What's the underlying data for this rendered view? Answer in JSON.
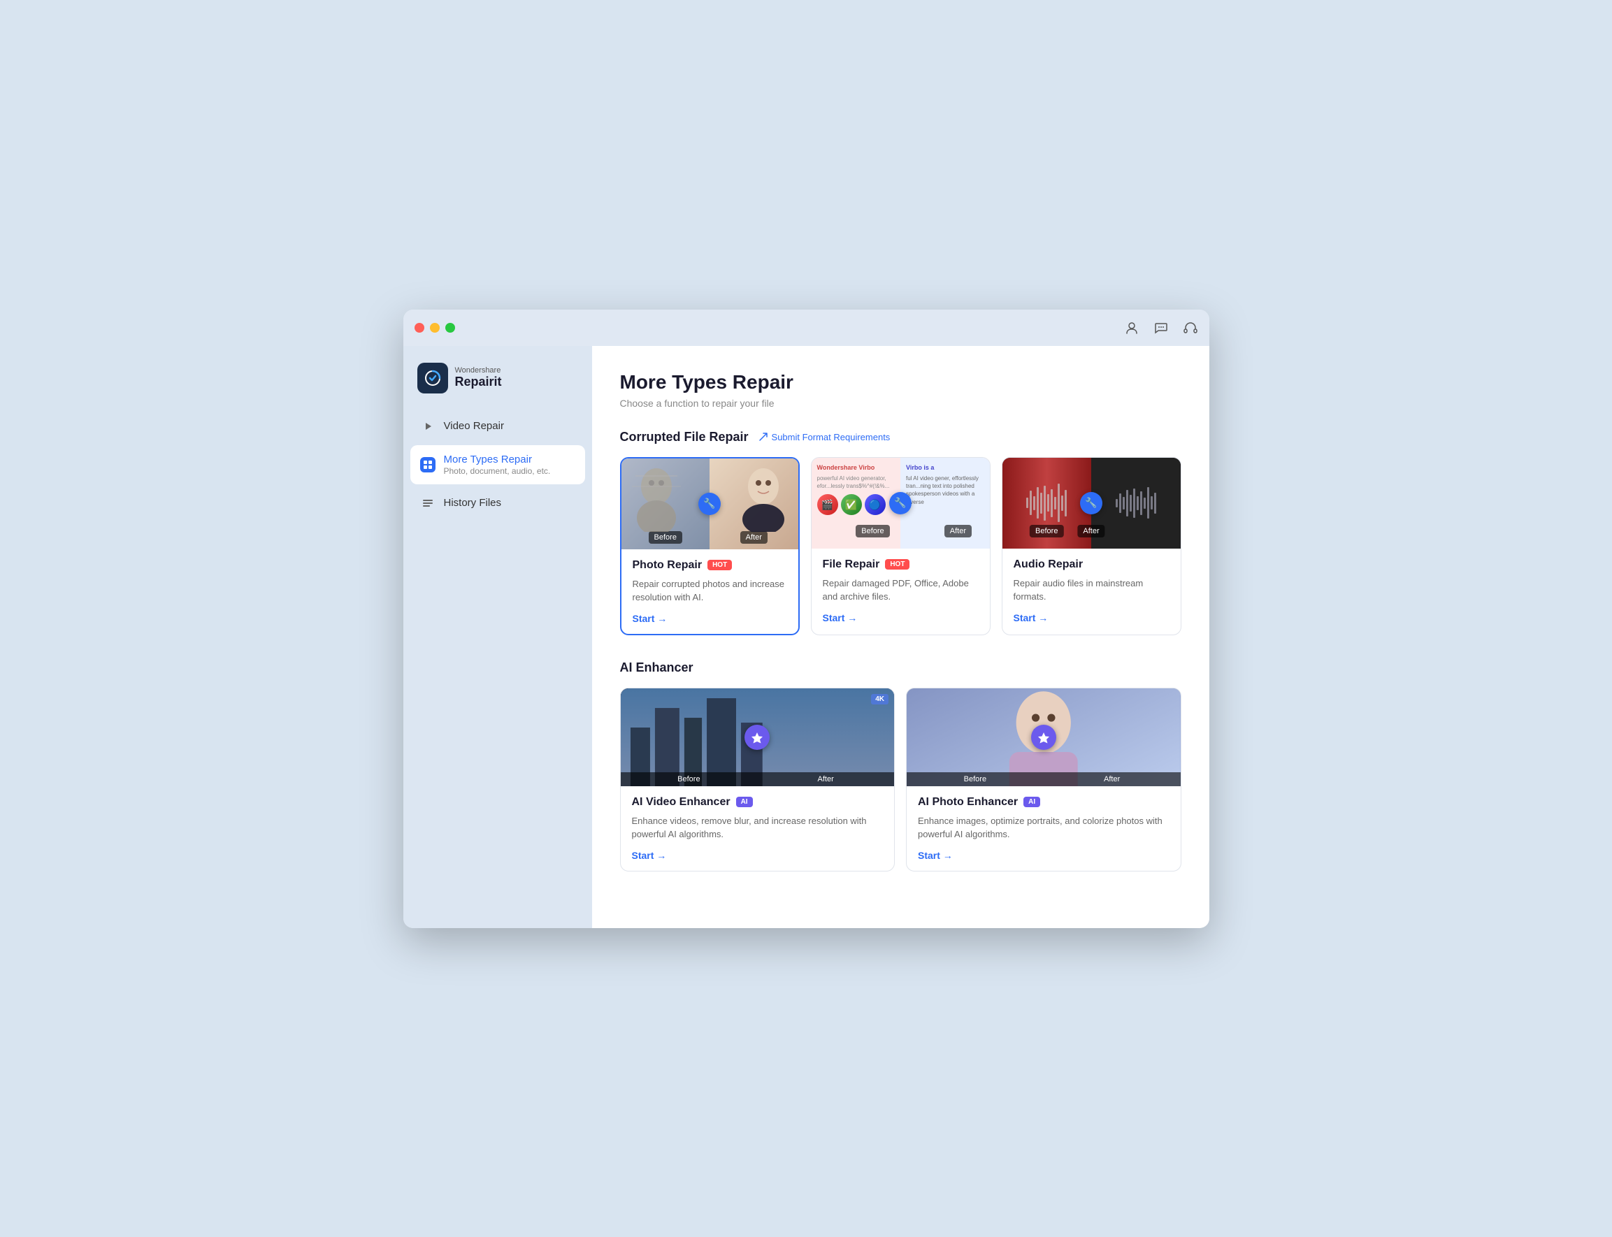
{
  "window": {
    "title": "Wondershare Repairit"
  },
  "titlebar": {
    "tl_red": "close",
    "tl_yellow": "minimize",
    "tl_green": "maximize"
  },
  "sidebar": {
    "logo": {
      "brand": "Wondershare",
      "name": "Repairit"
    },
    "nav": [
      {
        "id": "video-repair",
        "label": "Video Repair",
        "sublabel": "",
        "active": false
      },
      {
        "id": "more-types-repair",
        "label": "More Types Repair",
        "sublabel": "Photo, document, audio, etc.",
        "active": true
      },
      {
        "id": "history-files",
        "label": "History Files",
        "sublabel": "",
        "active": false
      }
    ]
  },
  "main": {
    "page_title": "More Types Repair",
    "page_subtitle": "Choose a function to repair your file",
    "corrupted_section": {
      "title": "Corrupted File Repair",
      "link_label": "Submit Format Requirements",
      "cards": [
        {
          "id": "photo-repair",
          "title": "Photo Repair",
          "badge": "HOT",
          "badge_type": "hot",
          "desc": "Repair corrupted photos and increase resolution with AI.",
          "start_label": "Start →",
          "selected": true
        },
        {
          "id": "file-repair",
          "title": "File Repair",
          "badge": "HOT",
          "badge_type": "hot",
          "desc": "Repair damaged PDF, Office, Adobe and archive files.",
          "start_label": "Start →",
          "selected": false
        },
        {
          "id": "audio-repair",
          "title": "Audio Repair",
          "badge": "",
          "badge_type": "",
          "desc": "Repair audio files in mainstream formats.",
          "start_label": "Start →",
          "selected": false
        }
      ]
    },
    "ai_section": {
      "title": "AI Enhancer",
      "cards": [
        {
          "id": "ai-video-enhancer",
          "title": "AI Video Enhancer",
          "badge": "AI",
          "badge_type": "ai",
          "desc": "Enhance videos, remove blur, and increase resolution with powerful AI algorithms.",
          "start_label": "Start →"
        },
        {
          "id": "ai-photo-enhancer",
          "title": "AI Photo Enhancer",
          "badge": "AI",
          "badge_type": "ai",
          "desc": "Enhance images, optimize portraits, and colorize photos with powerful AI algorithms.",
          "start_label": "Start →"
        }
      ]
    }
  },
  "labels": {
    "before": "Before",
    "after": "After",
    "4k": "4K"
  }
}
